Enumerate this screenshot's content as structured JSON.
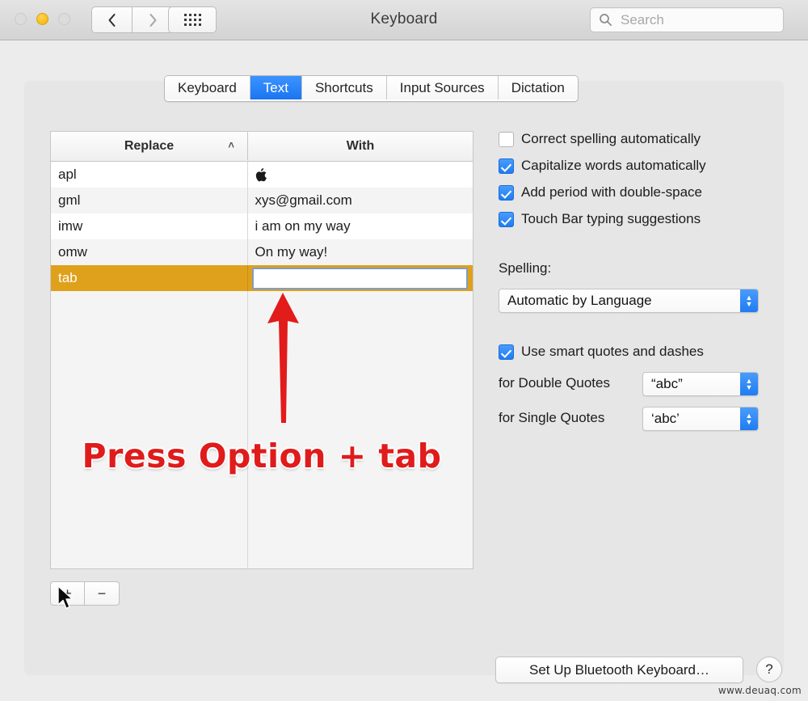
{
  "window": {
    "title": "Keyboard",
    "traffic_lights": {
      "close": "close-disabled",
      "minimize": "minimize",
      "zoom": "zoom-disabled"
    },
    "nav": {
      "back": "back-chevron-icon",
      "forward": "forward-chevron-icon",
      "show_all": "show-all-grid-icon"
    }
  },
  "search": {
    "placeholder": "Search",
    "value": "",
    "icon": "search-icon"
  },
  "tabs": [
    {
      "label": "Keyboard",
      "active": false
    },
    {
      "label": "Text",
      "active": true
    },
    {
      "label": "Shortcuts",
      "active": false
    },
    {
      "label": "Input Sources",
      "active": false
    },
    {
      "label": "Dictation",
      "active": false
    }
  ],
  "table": {
    "columns": [
      {
        "label": "Replace",
        "sort_indicator": "˄"
      },
      {
        "label": "With",
        "sort_indicator": ""
      }
    ],
    "rows": [
      {
        "replace": "apl",
        "with": "",
        "selected": false,
        "editing": false
      },
      {
        "replace": "gml",
        "with": "xys@gmail.com",
        "selected": false,
        "editing": false
      },
      {
        "replace": "imw",
        "with": "i am on my way",
        "selected": false,
        "editing": false
      },
      {
        "replace": "omw",
        "with": "On my way!",
        "selected": false,
        "editing": false
      },
      {
        "replace": "tab",
        "with": "",
        "selected": true,
        "editing": true
      }
    ],
    "edit_field_value": "",
    "add_button": "+",
    "remove_button": "−"
  },
  "options": {
    "checkboxes": [
      {
        "label": "Correct spelling automatically",
        "checked": false
      },
      {
        "label": "Capitalize words automatically",
        "checked": true
      },
      {
        "label": "Add period with double-space",
        "checked": true
      },
      {
        "label": "Touch Bar typing suggestions",
        "checked": true
      }
    ],
    "spelling_label": "Spelling:",
    "spelling_value": "Automatic by Language",
    "smart_quotes": {
      "label": "Use smart quotes and dashes",
      "checked": true
    },
    "double_quotes_label": "for Double Quotes",
    "double_quotes_value": "“abc”",
    "single_quotes_label": "for Single Quotes",
    "single_quotes_value": "‘abc’",
    "stepper_glyphs": {
      "up": "▲",
      "down": "▼"
    }
  },
  "annotation": {
    "text": "Press Option + tab",
    "arrow": "red-up-arrow",
    "color": "#e01b1b"
  },
  "footer": {
    "bluetooth_button": "Set Up Bluetooth Keyboard…",
    "help_button": "?",
    "watermark": "www.deuaq.com"
  },
  "colors": {
    "accent_blue": "#1f7cf2",
    "selection_orange": "#dfa01b",
    "annotation_red": "#e01b1b",
    "window_bg": "#ececec"
  }
}
